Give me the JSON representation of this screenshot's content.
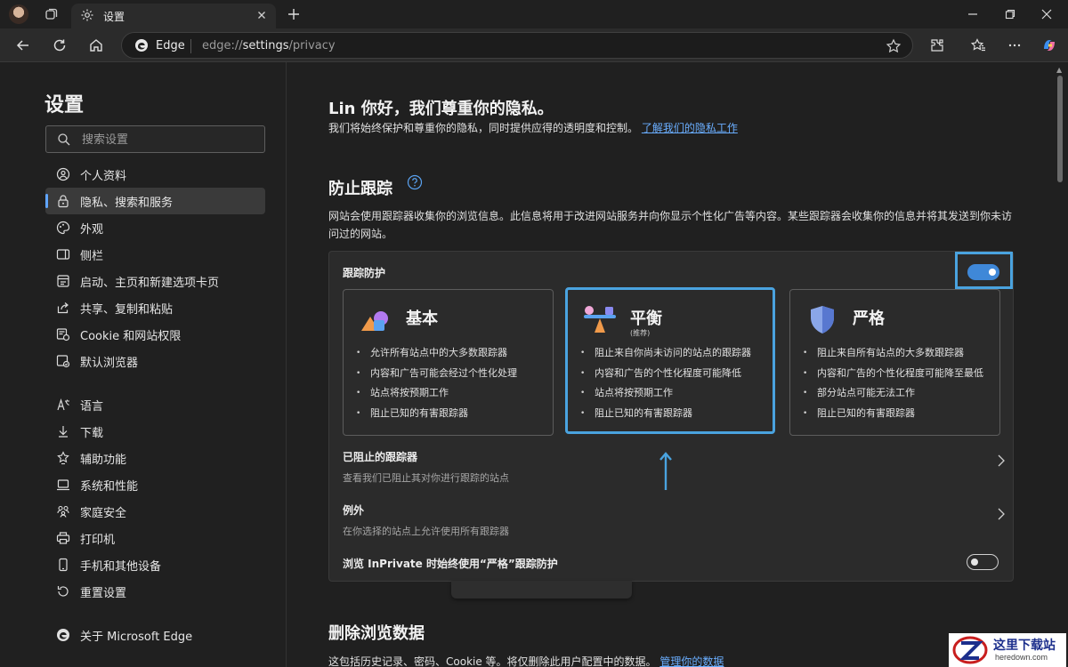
{
  "titlebar": {
    "tab_title": "设置"
  },
  "toolbar": {
    "omnibox_label": "Edge",
    "url_prefix": "edge://",
    "url_host": "settings",
    "url_path": "/privacy"
  },
  "sidebar": {
    "title": "设置",
    "search_placeholder": "搜索设置",
    "items": [
      {
        "label": "个人资料",
        "icon": "profile-icon"
      },
      {
        "label": "隐私、搜索和服务",
        "icon": "lock-icon",
        "active": true
      },
      {
        "label": "外观",
        "icon": "appearance-icon"
      },
      {
        "label": "侧栏",
        "icon": "sidebar-icon"
      },
      {
        "label": "启动、主页和新建选项卡页",
        "icon": "home-tabs-icon"
      },
      {
        "label": "共享、复制和粘贴",
        "icon": "share-icon"
      },
      {
        "label": "Cookie 和网站权限",
        "icon": "cookie-icon"
      },
      {
        "label": "默认浏览器",
        "icon": "default-browser-icon"
      },
      {
        "label": "语言",
        "icon": "language-icon"
      },
      {
        "label": "下载",
        "icon": "download-icon"
      },
      {
        "label": "辅助功能",
        "icon": "accessibility-icon"
      },
      {
        "label": "系统和性能",
        "icon": "system-icon"
      },
      {
        "label": "家庭安全",
        "icon": "family-icon"
      },
      {
        "label": "打印机",
        "icon": "printer-icon"
      },
      {
        "label": "手机和其他设备",
        "icon": "phone-icon"
      },
      {
        "label": "重置设置",
        "icon": "reset-icon"
      },
      {
        "label": "关于 Microsoft Edge",
        "icon": "edge-logo-icon"
      }
    ]
  },
  "main": {
    "greeting": "Lin 你好，我们尊重你的隐私。",
    "intro_text": "我们将始终保护和尊重你的隐私，同时提供应得的透明度和控制。",
    "intro_link": "了解我们的隐私工作",
    "tracking_section_title": "防止跟踪",
    "tracking_desc": "网站会使用跟踪器收集你的浏览信息。此信息将用于改进网站服务并向你显示个性化广告等内容。某些跟踪器会收集你的信息并将其发送到你未访问过的网站。",
    "tracking_prevention_label": "跟踪防护",
    "tracking_prevention_on": true,
    "options": [
      {
        "title": "基本",
        "subtitle": "",
        "selected": false,
        "bullets": [
          "允许所有站点中的大多数跟踪器",
          "内容和广告可能会经过个性化处理",
          "站点将按预期工作",
          "阻止已知的有害跟踪器"
        ]
      },
      {
        "title": "平衡",
        "subtitle": "(推荐)",
        "selected": true,
        "bullets": [
          "阻止来自你尚未访问的站点的跟踪器",
          "内容和广告的个性化程度可能降低",
          "站点将按预期工作",
          "阻止已知的有害跟踪器"
        ]
      },
      {
        "title": "严格",
        "subtitle": "",
        "selected": false,
        "bullets": [
          "阻止来自所有站点的大多数跟踪器",
          "内容和广告的个性化程度可能降至最低",
          "部分站点可能无法工作",
          "阻止已知的有害跟踪器"
        ]
      }
    ],
    "blocked_trackers_title": "已阻止的跟踪器",
    "blocked_trackers_sub": "查看我们已阻止其对你进行跟踪的站点",
    "exceptions_title": "例外",
    "exceptions_sub": "在你选择的站点上允许使用所有跟踪器",
    "inprivate_label": "浏览 InPrivate 时始终使用“严格”跟踪防护",
    "inprivate_on": false,
    "clear_section_title": "删除浏览数据",
    "clear_desc": "这包括历史记录、密码、Cookie 等。将仅删除此用户配置中的数据。",
    "clear_link": "管理你的数据"
  },
  "watermark": {
    "text": "这里下载站",
    "url": "heredown.com"
  },
  "colors": {
    "accent": "#3f88d8",
    "highlight": "#4aa3df",
    "link": "#6aaeff",
    "background": "#202020",
    "card": "#2b2b2b"
  }
}
